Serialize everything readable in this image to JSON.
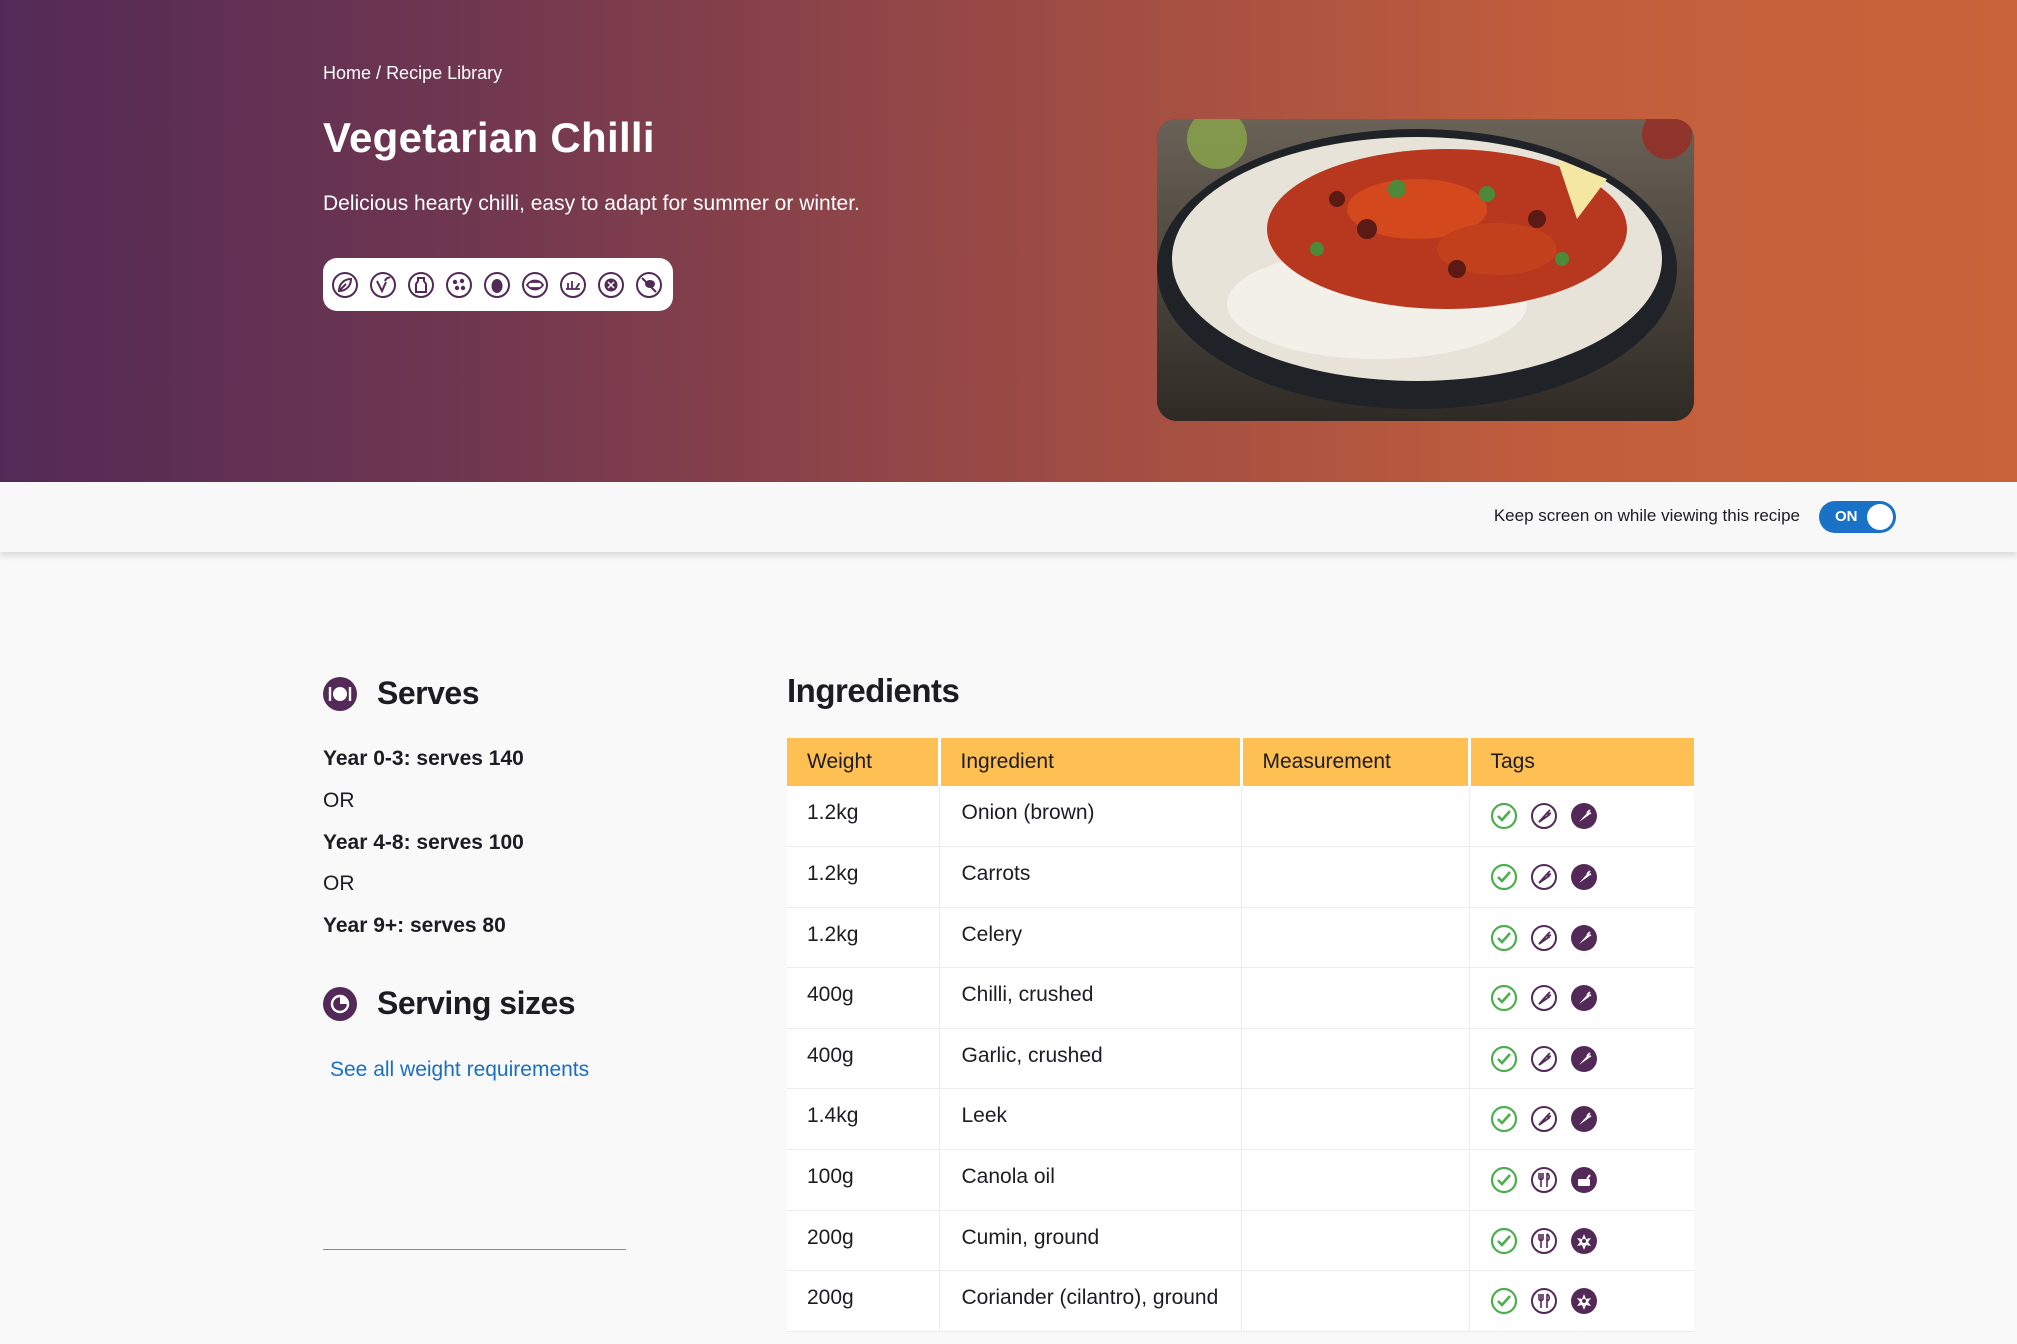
{
  "breadcrumb": {
    "home": "Home",
    "separator": "/",
    "current": "Recipe Library"
  },
  "recipe": {
    "title": "Vegetarian Chilli",
    "subtitle": "Delicious hearty chilli, easy to adapt for summer or winter.",
    "diet_icons": [
      "vegetarian-icon",
      "vegan-icon",
      "dairy-free-icon",
      "nut-free-icon",
      "egg-free-icon",
      "seafood-free-icon",
      "halal-icon",
      "gluten-free-icon",
      "no-allergen-icon"
    ]
  },
  "toolbar": {
    "keep_screen_label": "Keep screen on while viewing this recipe",
    "toggle_state": "ON"
  },
  "serves": {
    "heading": "Serves",
    "lines": [
      "Year 0-3: serves 140",
      "OR",
      "Year 4-8: serves 100",
      "OR",
      "Year 9+: serves 80"
    ]
  },
  "serving_sizes": {
    "heading": "Serving sizes",
    "link": "See all weight requirements"
  },
  "ingredients": {
    "heading": "Ingredients",
    "columns": [
      "Weight",
      "Ingredient",
      "Measurement",
      "Tags"
    ],
    "rows": [
      {
        "weight": "1.2kg",
        "ingredient": "Onion (brown)",
        "measurement": "",
        "tags": [
          "check-icon",
          "carrot-outline-icon",
          "carrot-filled-icon"
        ]
      },
      {
        "weight": "1.2kg",
        "ingredient": "Carrots",
        "measurement": "",
        "tags": [
          "check-icon",
          "carrot-outline-icon",
          "carrot-filled-icon"
        ]
      },
      {
        "weight": "1.2kg",
        "ingredient": "Celery",
        "measurement": "",
        "tags": [
          "check-icon",
          "carrot-outline-icon",
          "carrot-filled-icon"
        ]
      },
      {
        "weight": "400g",
        "ingredient": "Chilli, crushed",
        "measurement": "",
        "tags": [
          "check-icon",
          "carrot-outline-icon",
          "carrot-filled-icon"
        ]
      },
      {
        "weight": "400g",
        "ingredient": "Garlic, crushed",
        "measurement": "",
        "tags": [
          "check-icon",
          "carrot-outline-icon",
          "carrot-filled-icon"
        ]
      },
      {
        "weight": "1.4kg",
        "ingredient": "Leek",
        "measurement": "",
        "tags": [
          "check-icon",
          "carrot-outline-icon",
          "carrot-filled-icon"
        ]
      },
      {
        "weight": "100g",
        "ingredient": "Canola oil",
        "measurement": "",
        "tags": [
          "check-icon",
          "cutlery-icon",
          "oil-icon"
        ]
      },
      {
        "weight": "200g",
        "ingredient": "Cumin, ground",
        "measurement": "",
        "tags": [
          "check-icon",
          "cutlery-icon",
          "spice-icon"
        ]
      },
      {
        "weight": "200g",
        "ingredient": "Coriander (cilantro), ground",
        "measurement": "",
        "tags": [
          "check-icon",
          "cutlery-icon",
          "spice-icon"
        ]
      }
    ]
  },
  "colors": {
    "accent": "#532a57",
    "header_row": "#febf53",
    "link": "#1a6ec4",
    "toggle": "#1a72c7",
    "check": "#4cae4f"
  }
}
